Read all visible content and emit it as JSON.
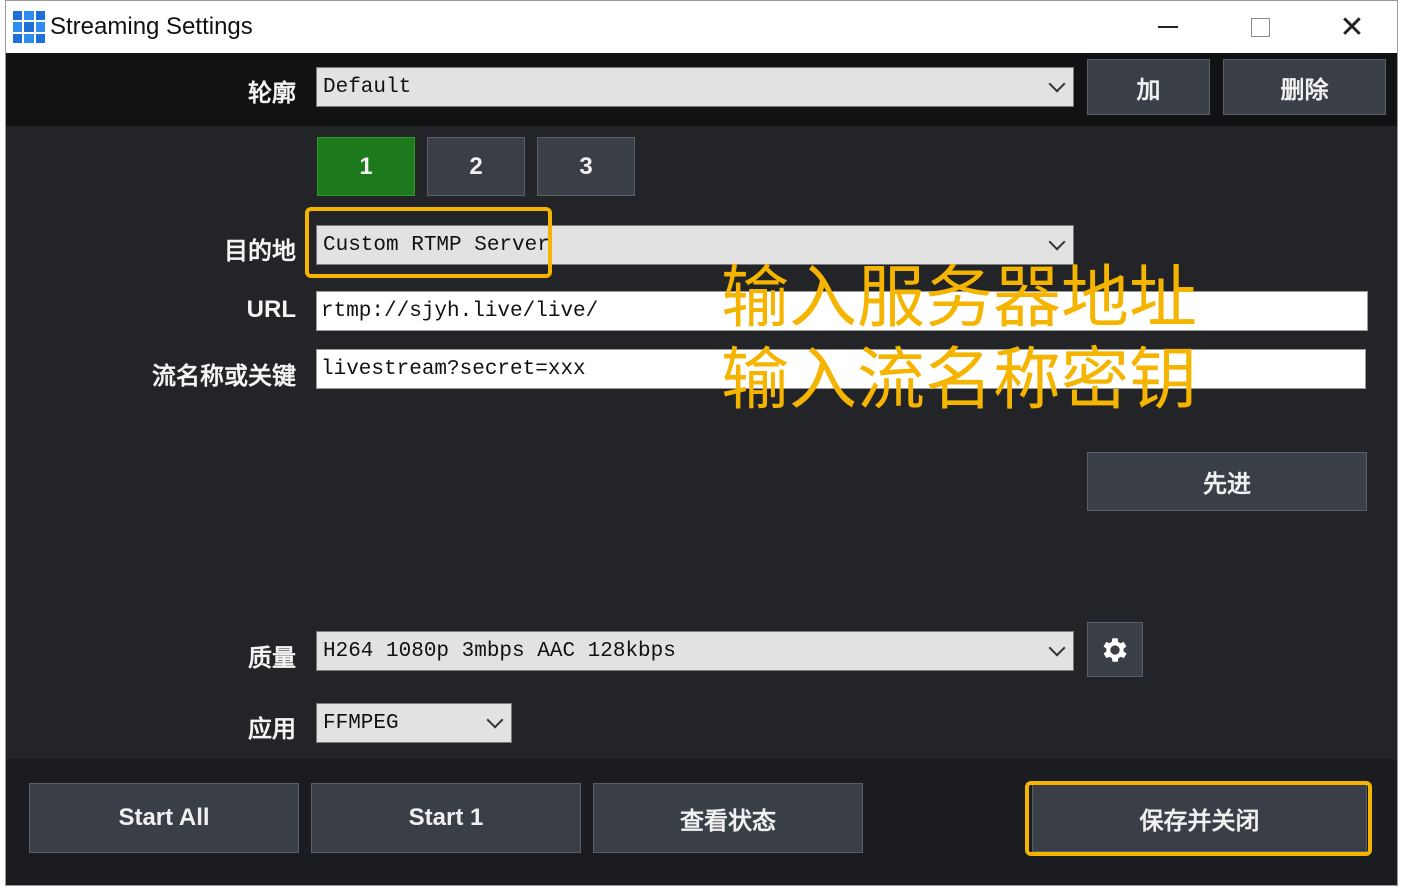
{
  "window": {
    "title": "Streaming Settings"
  },
  "profile": {
    "label": "轮廓",
    "value": "Default",
    "add_label": "加",
    "delete_label": "删除"
  },
  "tabs": [
    {
      "label": "1",
      "active": true
    },
    {
      "label": "2",
      "active": false
    },
    {
      "label": "3",
      "active": false
    }
  ],
  "destination": {
    "label": "目的地",
    "value": "Custom RTMP Server"
  },
  "url": {
    "label": "URL",
    "value": "rtmp://sjyh.live/live/"
  },
  "stream_key": {
    "label": "流名称或关键",
    "value": "livestream?secret=xxx"
  },
  "advanced_label": "先进",
  "quality": {
    "label": "质量",
    "value": "H264 1080p 3mbps AAC 128kbps"
  },
  "application": {
    "label": "应用",
    "value": "FFMPEG"
  },
  "bottom": {
    "start_all": "Start All",
    "start_1": "Start 1",
    "view_status": "查看状态",
    "save_close": "保存并关闭"
  },
  "annotations": {
    "line1": "输入服务器地址",
    "line2": "输入流名称密钥"
  },
  "colors": {
    "highlight": "#f5b400",
    "active_tab": "#1c7a1c",
    "background": "#232427"
  },
  "icons": {
    "app": "grid-app-icon",
    "gear": "gear-icon",
    "chevron": "chevron-down-icon"
  }
}
